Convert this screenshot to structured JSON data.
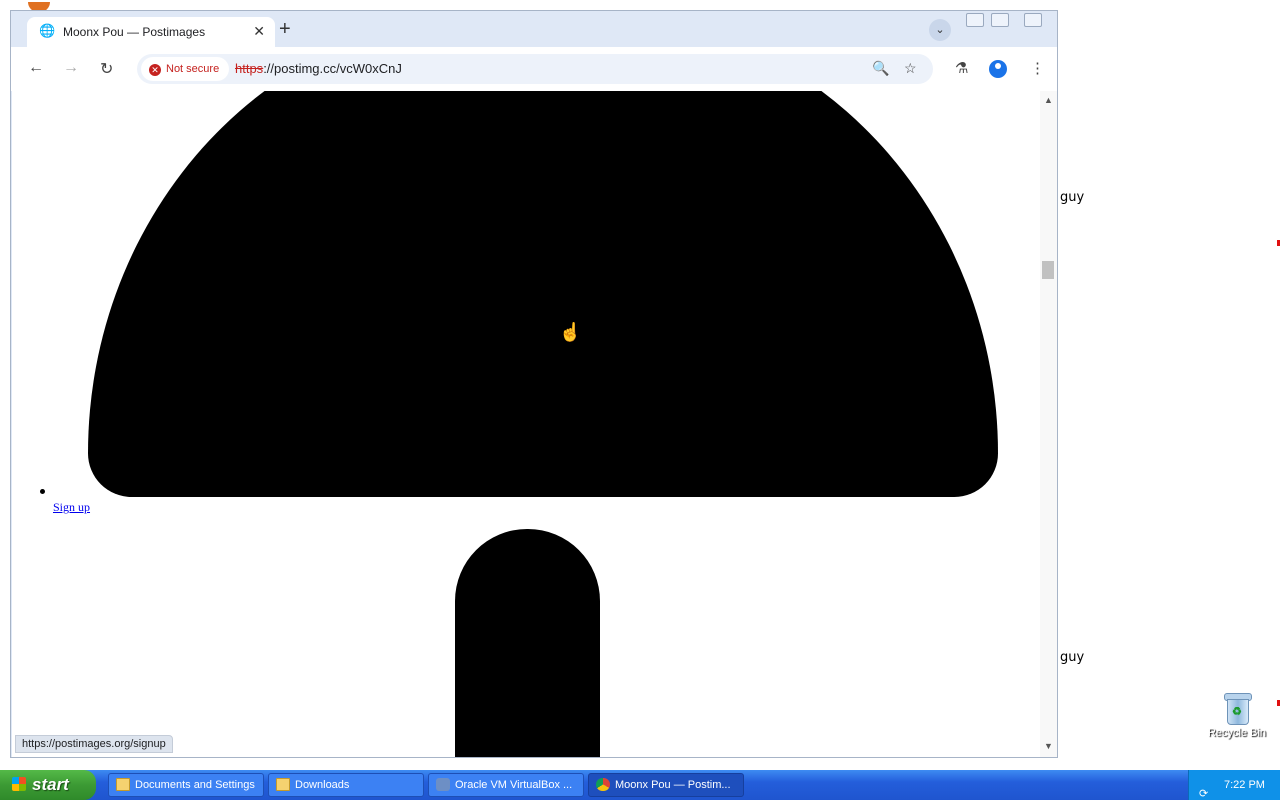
{
  "desktop": {
    "side_texts": [
      "guy",
      "guy"
    ],
    "recycle_bin_label": "Recycle Bin"
  },
  "browser": {
    "tab": {
      "title": "Moonx Pou — Postimages"
    },
    "url": {
      "scheme": "https",
      "rest": "://postimg.cc/vcW0xCnJ"
    },
    "security_label": "Not secure"
  },
  "page": {
    "signup_link": "Sign up",
    "status_url": "https://postimages.org/signup"
  },
  "taskbar": {
    "start_label": "start",
    "items": [
      {
        "label": "Documents and Settings",
        "icon": "folder-icon"
      },
      {
        "label": "Downloads",
        "icon": "folder-icon"
      },
      {
        "label": "Oracle VM VirtualBox ...",
        "icon": "virtualbox-icon"
      },
      {
        "label": "Moonx Pou — Postim...",
        "icon": "chrome-icon",
        "active": true
      }
    ],
    "clock": "7:22 PM"
  },
  "colors": {
    "not_secure": "#c5221f",
    "taskbar_blue": "#245edb",
    "start_green": "#3c9a34",
    "link": "#0000ee"
  }
}
